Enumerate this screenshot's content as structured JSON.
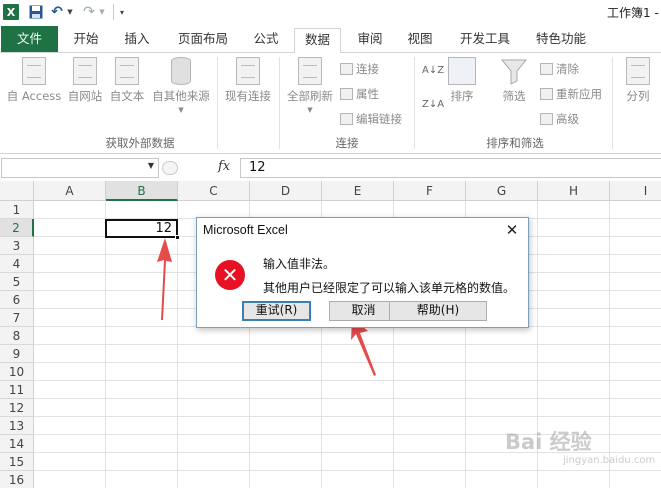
{
  "window": {
    "title": "工作簿1 -"
  },
  "tabs": [
    {
      "label": "文件"
    },
    {
      "label": "开始"
    },
    {
      "label": "插入"
    },
    {
      "label": "页面布局"
    },
    {
      "label": "公式"
    },
    {
      "label": "数据"
    },
    {
      "label": "审阅"
    },
    {
      "label": "视图"
    },
    {
      "label": "开发工具"
    },
    {
      "label": "特色功能"
    }
  ],
  "ribbon": {
    "get_external": {
      "label": "获取外部数据",
      "buttons": [
        "自 Access",
        "自网站",
        "自文本",
        "自其他来源",
        "现有连接"
      ]
    },
    "connections": {
      "label": "连接",
      "refresh_all": "全部刷新",
      "items": [
        "连接",
        "属性",
        "编辑链接"
      ]
    },
    "sort_filter": {
      "label": "排序和筛选",
      "sort": "排序",
      "filter": "筛选",
      "items": [
        "清除",
        "重新应用",
        "高级"
      ],
      "sort_az": "A↓Z",
      "sort_za": "Z↓A"
    },
    "split": {
      "label": "分列"
    }
  },
  "formula_bar": {
    "fx": "fx",
    "value": "12"
  },
  "sheet": {
    "columns": [
      "A",
      "B",
      "C",
      "D",
      "E",
      "F",
      "G",
      "H",
      "I"
    ],
    "rows": [
      "1",
      "2",
      "3",
      "4",
      "5",
      "6",
      "7",
      "8",
      "9",
      "10",
      "11",
      "12",
      "13",
      "14",
      "15",
      "16"
    ],
    "active_cell_value": "12"
  },
  "dialog": {
    "title": "Microsoft Excel",
    "message_1": "输入值非法。",
    "message_2": "其他用户已经限定了可以输入该单元格的数值。",
    "retry": "重试(R)",
    "cancel": "取消",
    "help": "帮助(H)"
  },
  "watermark": {
    "text": "Bai 经验",
    "sub": "jingyan.baidu.com"
  },
  "colors": {
    "excel_green": "#217346",
    "arrow_red": "#e64b4b",
    "error_red": "#e81123"
  }
}
